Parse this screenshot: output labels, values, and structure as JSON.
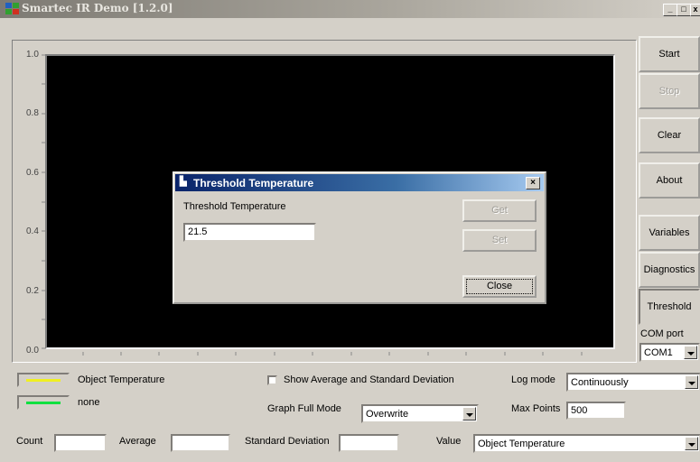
{
  "window": {
    "title": "Smartec IR Demo [1.2.0]",
    "min": "_",
    "max": "□",
    "close": "x"
  },
  "chart": {
    "y_labels": [
      "1.0",
      "0.8",
      "0.6",
      "0.4",
      "0.2",
      "0.0"
    ]
  },
  "sidebar": {
    "start": "Start",
    "stop": "Stop",
    "clear": "Clear",
    "about": "About",
    "variables": "Variables",
    "diagnostics": "Diagnostics",
    "threshold": "Threshold",
    "com_label": "COM port",
    "com_value": "COM1"
  },
  "legend": {
    "series1": "Object Temperature",
    "series1_color": "#f0f020",
    "series2": "none",
    "series2_color": "#10e040"
  },
  "options": {
    "show_avg_label": "Show Average and Standard Deviation",
    "graph_mode_label": "Graph Full Mode",
    "graph_mode_value": "Overwrite",
    "log_mode_label": "Log mode",
    "log_mode_value": "Continuously",
    "max_points_label": "Max Points",
    "max_points_value": "500"
  },
  "stats": {
    "count_label": "Count",
    "count_value": "",
    "average_label": "Average",
    "average_value": "",
    "stddev_label": "Standard Deviation",
    "stddev_value": "",
    "value_label": "Value",
    "value_select": "Object Temperature"
  },
  "dialog": {
    "title": "Threshold Temperature",
    "field_label": "Threshold Temperature",
    "field_value": "21.5",
    "get": "Get",
    "set": "Set",
    "close": "Close",
    "close_x": "×"
  }
}
